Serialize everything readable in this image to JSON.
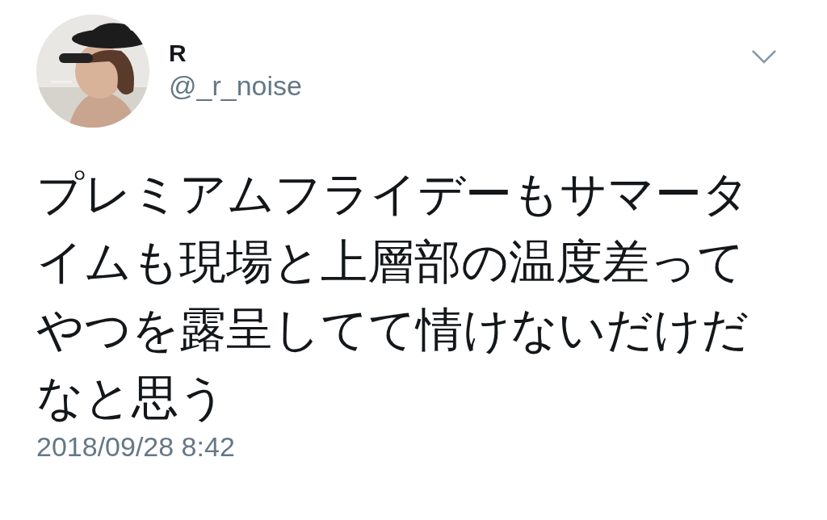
{
  "tweet": {
    "author": {
      "name": "R",
      "handle": "@_r_noise"
    },
    "text": "プレミアムフライデーもサマータイムも現場と上層部の温度差ってやつを露呈してて情けないだけだなと思う",
    "timestamp": "2018/09/28 8:42"
  }
}
